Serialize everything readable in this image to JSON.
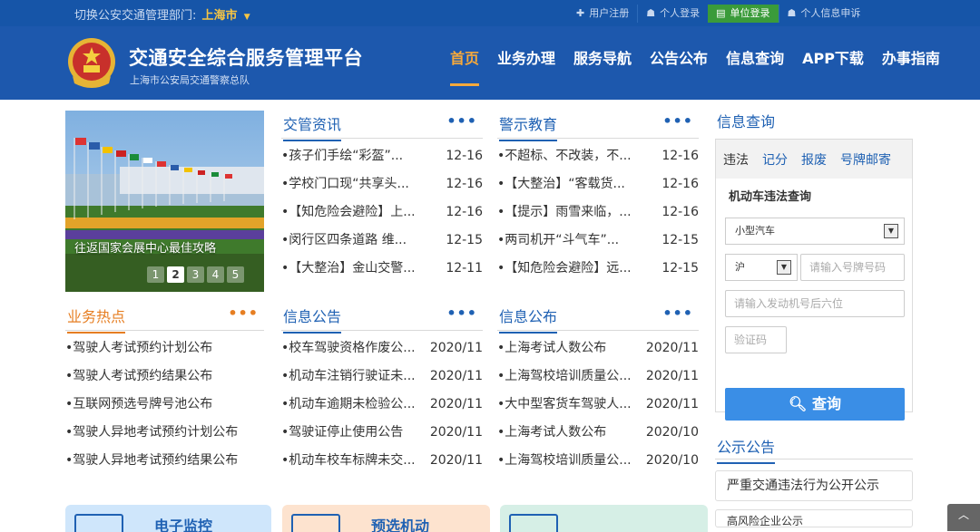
{
  "topbar": {
    "switch_label": "切换公安交通管理部门:",
    "city": "上海市",
    "links": [
      {
        "icon": "plus-icon",
        "glyph": "✚",
        "label": "用户注册"
      },
      {
        "icon": "user-icon",
        "glyph": "☗",
        "label": "个人登录"
      },
      {
        "icon": "building-icon",
        "glyph": "▤",
        "label": "单位登录"
      },
      {
        "icon": "user-icon",
        "glyph": "☗",
        "label": "个人信息申诉"
      }
    ]
  },
  "header": {
    "title": "交通安全综合服务管理平台",
    "subtitle": "上海市公安局交通警察总队",
    "nav": [
      "首页",
      "业务办理",
      "服务导航",
      "公告公布",
      "信息查询",
      "APP下载",
      "办事指南"
    ]
  },
  "carousel": {
    "caption": "往返国家会展中心最佳攻略",
    "pages": [
      "1",
      "2",
      "3",
      "4",
      "5"
    ],
    "active_page": "2"
  },
  "sections": {
    "traffic_news": {
      "title": "交管资讯",
      "more": "•••",
      "items": [
        {
          "text": "•孩子们手绘“彩盔”...",
          "date": "12-16"
        },
        {
          "text": "•学校门口现“共享头...",
          "date": "12-16"
        },
        {
          "text": "•【知危险会避险】上...",
          "date": "12-16"
        },
        {
          "text": "•闵行区四条道路 维...",
          "date": "12-15"
        },
        {
          "text": "•【大整治】金山交警...",
          "date": "12-11"
        }
      ]
    },
    "warning_edu": {
      "title": "警示教育",
      "more": "•••",
      "items": [
        {
          "text": "•不超标、不改装，不...",
          "date": "12-16"
        },
        {
          "text": "•【大整治】“客载货...",
          "date": "12-16"
        },
        {
          "text": "•【提示】雨雪来临，...",
          "date": "12-16"
        },
        {
          "text": "•两司机开“斗气车”...",
          "date": "12-15"
        },
        {
          "text": "•【知危险会避险】远...",
          "date": "12-15"
        }
      ]
    },
    "hot_business": {
      "title": "业务热点",
      "more": "•••",
      "items": [
        {
          "text": "•驾驶人考试预约计划公布"
        },
        {
          "text": "•驾驶人考试预约结果公布"
        },
        {
          "text": "•互联网预选号牌号池公布"
        },
        {
          "text": "•驾驶人异地考试预约计划公布"
        },
        {
          "text": "•驾驶人异地考试预约结果公布"
        }
      ]
    },
    "info_notice": {
      "title": "信息公告",
      "more": "•••",
      "items": [
        {
          "text": "•校车驾驶资格作废公...",
          "date": "2020/11"
        },
        {
          "text": "•机动车注销行驶证未...",
          "date": "2020/11"
        },
        {
          "text": "•机动车逾期未检验公...",
          "date": "2020/11"
        },
        {
          "text": "•驾驶证停止使用公告",
          "date": "2020/11"
        },
        {
          "text": "•机动车校车标牌未交...",
          "date": "2020/11"
        }
      ]
    },
    "info_publish": {
      "title": "信息公布",
      "more": "•••",
      "items": [
        {
          "text": "•上海考试人数公布",
          "date": "2020/11"
        },
        {
          "text": "•上海驾校培训质量公...",
          "date": "2020/11"
        },
        {
          "text": "•大中型客货车驾驶人...",
          "date": "2020/11"
        },
        {
          "text": "•上海考试人数公布",
          "date": "2020/10"
        },
        {
          "text": "•上海驾校培训质量公...",
          "date": "2020/10"
        }
      ]
    }
  },
  "query": {
    "title": "信息查询",
    "tabs": [
      "违法",
      "记分",
      "报废",
      "号牌邮寄"
    ],
    "subtitle": "机动车违法查询",
    "vehicle_type": "小型汽车",
    "plate_prefix": "沪",
    "plate_placeholder": "请输入号牌号码",
    "engine_placeholder": "请输入发动机号后六位",
    "captcha_placeholder": "验证码",
    "button": "查询"
  },
  "notice": {
    "title": "公示公告",
    "items": [
      "严重交通违法行为公开公示",
      "高风险企业公示"
    ]
  },
  "cards": [
    {
      "label": "电子监控",
      "color": "#cfe6fb"
    },
    {
      "label": "预选机动",
      "color": "#fde3cf"
    },
    {
      "label": "",
      "color": "#d6efe6"
    }
  ],
  "colors": {
    "topbar": "#1655a8",
    "header": "#1d58ad",
    "accent_orange": "#f6a93b",
    "link_blue": "#1f61b3",
    "button_blue": "#3a8ee6",
    "login_green": "#3a9b3a"
  }
}
